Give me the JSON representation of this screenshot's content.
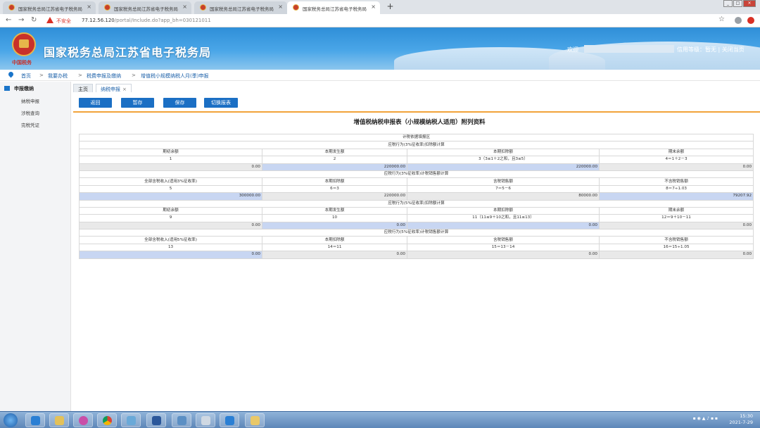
{
  "browser": {
    "tabs": [
      {
        "title": "国家税务总局江苏省电子税务局",
        "active": false
      },
      {
        "title": "国家税务总局江苏省电子税务局",
        "active": false
      },
      {
        "title": "国家税务总局江苏省电子税务局",
        "active": false
      },
      {
        "title": "国家税务总局江苏省电子税务局",
        "active": true
      }
    ],
    "new_tab_label": "+",
    "security_label": "不安全",
    "url_host": "77.12.56.120",
    "url_path": "/portal/Include.do?app_bh=030121011"
  },
  "header": {
    "site_title": "国家税务总局江苏省电子税务局",
    "emblem_text": "中国税务",
    "welcome": "欢迎",
    "user_info": "信用等级：暂无 | 关闭当页"
  },
  "breadcrumb": {
    "items": [
      "首页",
      "我要办税",
      "税费申报及缴纳",
      "增值税小规模纳税人月(季)申报"
    ],
    "separator": ">"
  },
  "sidebar": {
    "title": "申报缴纳",
    "items": [
      "纳税申报",
      "涉税查询",
      "完税凭证"
    ]
  },
  "page_tabs": [
    {
      "label": "主页",
      "active": false
    },
    {
      "label": "纳税申报",
      "active": true,
      "close": "×"
    }
  ],
  "actions": {
    "back": "返回",
    "draft": "暂存",
    "save": "保存",
    "switch": "切换报表"
  },
  "form": {
    "title": "增值税纳税申报表（小规模纳税人适用）附列资料",
    "section_main": "计税依据填报区",
    "sec1_title": "应税行为(3%征收率)扣除额计算",
    "sec1_headers": [
      "期初余额",
      "本期发生额",
      "本期扣除额",
      "期末余额"
    ],
    "sec1_formulas": [
      "1",
      "2",
      "3（3≤1＋2之和，且3≤5）",
      "4＝1＋2－3"
    ],
    "sec1_values": [
      "0.00",
      "220000.00",
      "220000.00",
      "0.00"
    ],
    "sec2_title": "应税行为(3%征收率)计税销售额计算",
    "sec2_headers": [
      "全部含税收入(适用3%征收率)",
      "本期扣除额",
      "含税销售额",
      "不含税销售额"
    ],
    "sec2_formulas": [
      "5",
      "6＝3",
      "7＝5－6",
      "8＝7÷1.03"
    ],
    "sec2_values": [
      "300000.00",
      "220000.00",
      "80000.00",
      "79207.92"
    ],
    "sec3_title": "应税行为(5%征收率)扣除额计算",
    "sec3_headers": [
      "期初余额",
      "本期发生额",
      "本期扣除额",
      "期末余额"
    ],
    "sec3_formulas": [
      "9",
      "10",
      "11（11≤9＋10之和，且11≤13）",
      "12＝9＋10－11"
    ],
    "sec3_values": [
      "0.00",
      "0.00",
      "0.00",
      "0.00"
    ],
    "sec4_title": "应税行为(5%征收率)计税销售额计算",
    "sec4_headers": [
      "全部含税收入(适用5%征收率)",
      "本期扣除额",
      "含税销售额",
      "不含税销售额"
    ],
    "sec4_formulas": [
      "13",
      "14＝11",
      "15＝13－14",
      "16＝15÷1.05"
    ],
    "sec4_values": [
      "0.00",
      "0.00",
      "0.00",
      "0.00"
    ]
  },
  "taskbar": {
    "time": "15:30",
    "date": "2021-7-29"
  }
}
